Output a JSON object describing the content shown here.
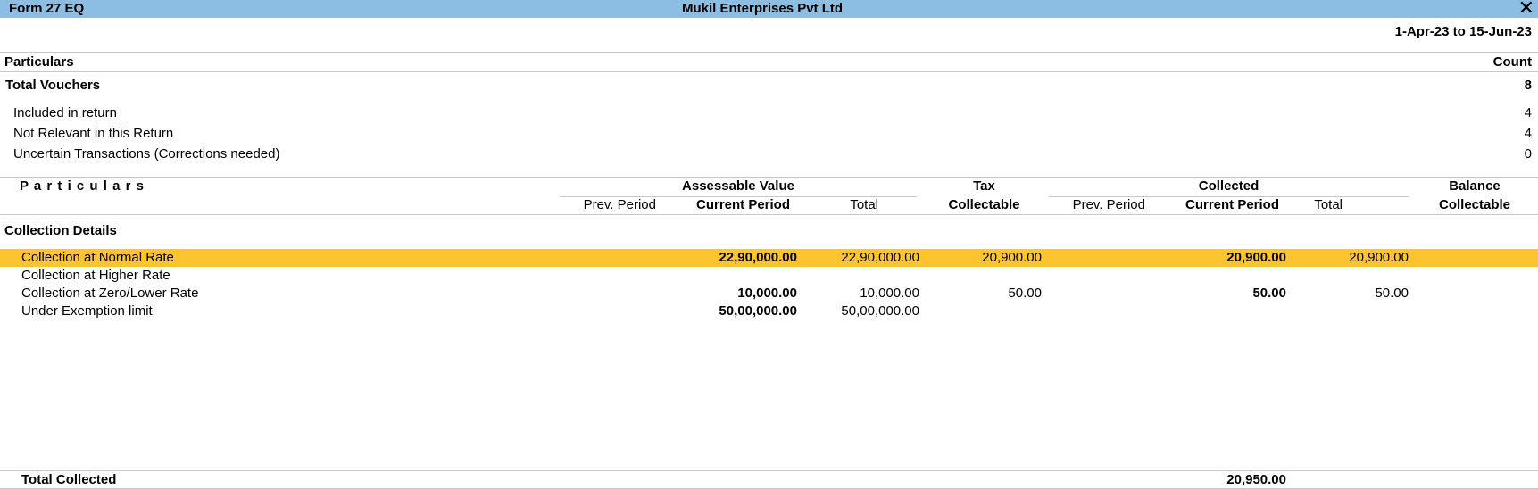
{
  "titlebar": {
    "report_name": "Form 27 EQ",
    "company": "Mukil Enterprises Pvt Ltd",
    "close_icon": "close-icon"
  },
  "period": "1-Apr-23 to 15-Jun-23",
  "summary": {
    "col_particulars": "Particulars",
    "col_count": "Count",
    "total_label": "Total Vouchers",
    "total_count": "8",
    "rows": [
      {
        "label": "Included in return",
        "count": "4"
      },
      {
        "label": "Not Relevant in this Return",
        "count": "4"
      },
      {
        "label": "Uncertain Transactions (Corrections needed)",
        "count": "0"
      }
    ]
  },
  "details_header": {
    "particulars": "P a r t i c u l a r s",
    "assessable_value": "Assessable Value",
    "tax": "Tax",
    "collectable": "Collectable",
    "collected": "Collected",
    "balance": "Balance",
    "balance_collectable": "Collectable",
    "prev_period": "Prev. Period",
    "current_period": "Current Period",
    "total": "Total"
  },
  "section_title": "Collection Details",
  "rows": [
    {
      "label": "Collection at Normal Rate",
      "av_cur": "22,90,000.00",
      "av_total": "22,90,000.00",
      "tax": "20,900.00",
      "col_cur": "20,900.00",
      "col_total": "20,900.00",
      "selected": true
    },
    {
      "label": "Collection at Higher Rate",
      "av_cur": "",
      "av_total": "",
      "tax": "",
      "col_cur": "",
      "col_total": "",
      "selected": false
    },
    {
      "label": "Collection at Zero/Lower Rate",
      "av_cur": "10,000.00",
      "av_total": "10,000.00",
      "tax": "50.00",
      "col_cur": "50.00",
      "col_total": "50.00",
      "selected": false
    },
    {
      "label": "Under Exemption limit",
      "av_cur": "50,00,000.00",
      "av_total": "50,00,000.00",
      "tax": "",
      "col_cur": "",
      "col_total": "",
      "selected": false
    }
  ],
  "footer": {
    "label": "Total Collected",
    "value": "20,950.00"
  },
  "colors": {
    "titlebar": "#8cbde3",
    "selection": "#fdc42f"
  }
}
